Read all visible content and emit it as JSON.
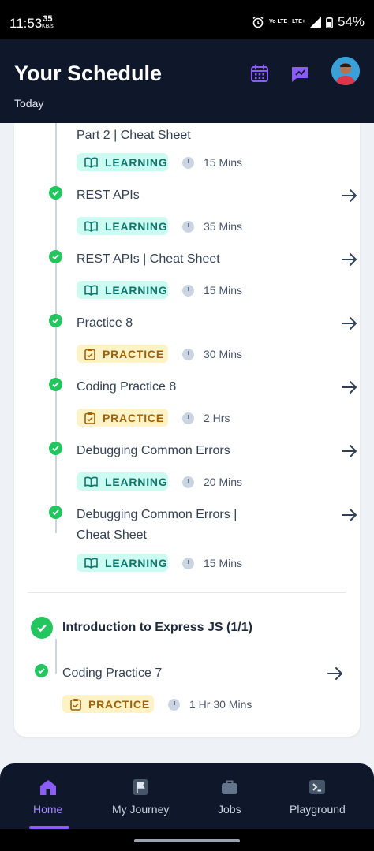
{
  "status_bar": {
    "time": "11:53",
    "speed": "35",
    "speed_unit": "KB/s",
    "network_1": "Vo LTE",
    "network_2": "LTE+",
    "battery": "54%"
  },
  "header": {
    "title": "Your Schedule",
    "subtitle": "Today"
  },
  "schedule": {
    "items": [
      {
        "title": "Part 2 | Cheat Sheet",
        "type": "LEARNING",
        "duration": "15 Mins"
      },
      {
        "title": "REST APIs",
        "type": "LEARNING",
        "duration": "35 Mins"
      },
      {
        "title": "REST APIs | Cheat Sheet",
        "type": "LEARNING",
        "duration": "15 Mins"
      },
      {
        "title": "Practice 8",
        "type": "PRACTICE",
        "duration": "30 Mins"
      },
      {
        "title": "Coding Practice 8",
        "type": "PRACTICE",
        "duration": "2 Hrs"
      },
      {
        "title": "Debugging Common Errors",
        "type": "LEARNING",
        "duration": "20 Mins"
      },
      {
        "title": "Debugging Common Errors | Cheat Sheet",
        "type": "LEARNING",
        "duration": "15 Mins"
      }
    ],
    "section": {
      "title": "Introduction to Express JS (1/1)"
    },
    "section_items": [
      {
        "title": "Coding Practice 7",
        "type": "PRACTICE",
        "duration": "1 Hr 30 Mins"
      }
    ]
  },
  "nav": {
    "items": [
      {
        "label": "Home",
        "icon": "home-icon",
        "active": true
      },
      {
        "label": "My Journey",
        "icon": "flag-icon"
      },
      {
        "label": "Jobs",
        "icon": "briefcase-icon"
      },
      {
        "label": "Playground",
        "icon": "terminal-icon"
      }
    ]
  },
  "colors": {
    "header_bg": "#0f172a",
    "accent": "#8b5cf6",
    "success": "#22c55e",
    "learning_bg": "#ccfbf1",
    "learning_fg": "#0f766e",
    "practice_bg": "#fef3c7",
    "practice_fg": "#a16207"
  }
}
